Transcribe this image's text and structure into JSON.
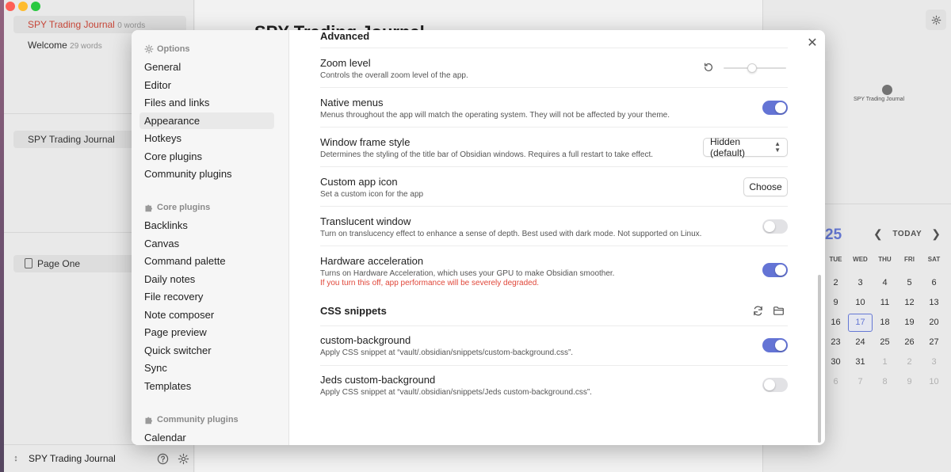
{
  "sidebar_left": {
    "files": [
      {
        "name": "SPY Trading Journal",
        "count": "0 words"
      },
      {
        "name": "Welcome",
        "count": "29 words"
      }
    ],
    "open_tab": "SPY Trading Journal",
    "bookmark": "Page One",
    "vault_name": "SPY Trading Journal"
  },
  "editor": {
    "title": "SPY Trading Journal"
  },
  "right_panel": {
    "graph_node_label": "SPY Trading Journal",
    "calendar": {
      "year_fragment": "25",
      "today_label": "TODAY",
      "weekdays": [
        "TUE",
        "WED",
        "THU",
        "FRI",
        "SAT"
      ],
      "weeks": [
        [
          "2",
          "3",
          "4",
          "5",
          "6"
        ],
        [
          "9",
          "10",
          "11",
          "12",
          "13"
        ],
        [
          "16",
          "17",
          "18",
          "19",
          "20"
        ],
        [
          "23",
          "24",
          "25",
          "26",
          "27"
        ],
        [
          "30",
          "31",
          "1",
          "2",
          "3"
        ],
        [
          "6",
          "7",
          "8",
          "9",
          "10"
        ]
      ],
      "today_date": "17"
    }
  },
  "settings": {
    "nav": {
      "options_heading": "Options",
      "options": [
        "General",
        "Editor",
        "Files and links",
        "Appearance",
        "Hotkeys",
        "Core plugins",
        "Community plugins"
      ],
      "active": "Appearance",
      "core_heading": "Core plugins",
      "core": [
        "Backlinks",
        "Canvas",
        "Command palette",
        "Daily notes",
        "File recovery",
        "Note composer",
        "Page preview",
        "Quick switcher",
        "Sync",
        "Templates"
      ],
      "community_heading": "Community plugins",
      "community": [
        "Calendar"
      ]
    },
    "advanced_heading": "Advanced",
    "zoom": {
      "name": "Zoom level",
      "desc": "Controls the overall zoom level of the app.",
      "value": 0.45
    },
    "native_menus": {
      "name": "Native menus",
      "desc": "Menus throughout the app will match the operating system. They will not be affected by your theme.",
      "enabled": true
    },
    "window_frame": {
      "name": "Window frame style",
      "desc": "Determines the styling of the title bar of Obsidian windows. Requires a full restart to take effect.",
      "value": "Hidden (default)"
    },
    "custom_icon": {
      "name": "Custom app icon",
      "desc": "Set a custom icon for the app",
      "button": "Choose"
    },
    "translucent": {
      "name": "Translucent window",
      "desc": "Turn on translucency effect to enhance a sense of depth. Best used with dark mode. Not supported on Linux.",
      "enabled": false
    },
    "hardware_accel": {
      "name": "Hardware acceleration",
      "desc": "Turns on Hardware Acceleration, which uses your GPU to make Obsidian smoother.",
      "warning": "If you turn this off, app performance will be severely degraded.",
      "enabled": true
    },
    "css_heading": "CSS snippets",
    "snippets": [
      {
        "name": "custom-background",
        "desc": "Apply CSS snippet at “vault/.obsidian/snippets/custom-background.css”.",
        "enabled": true
      },
      {
        "name": "Jeds custom-background",
        "desc": "Apply CSS snippet at “vault/.obsidian/snippets/Jeds custom-background.css”.",
        "enabled": false
      }
    ]
  },
  "colors": {
    "accent": "#6474d5",
    "warning": "#e0473a",
    "calendar_accent": "#6b7fe0"
  }
}
